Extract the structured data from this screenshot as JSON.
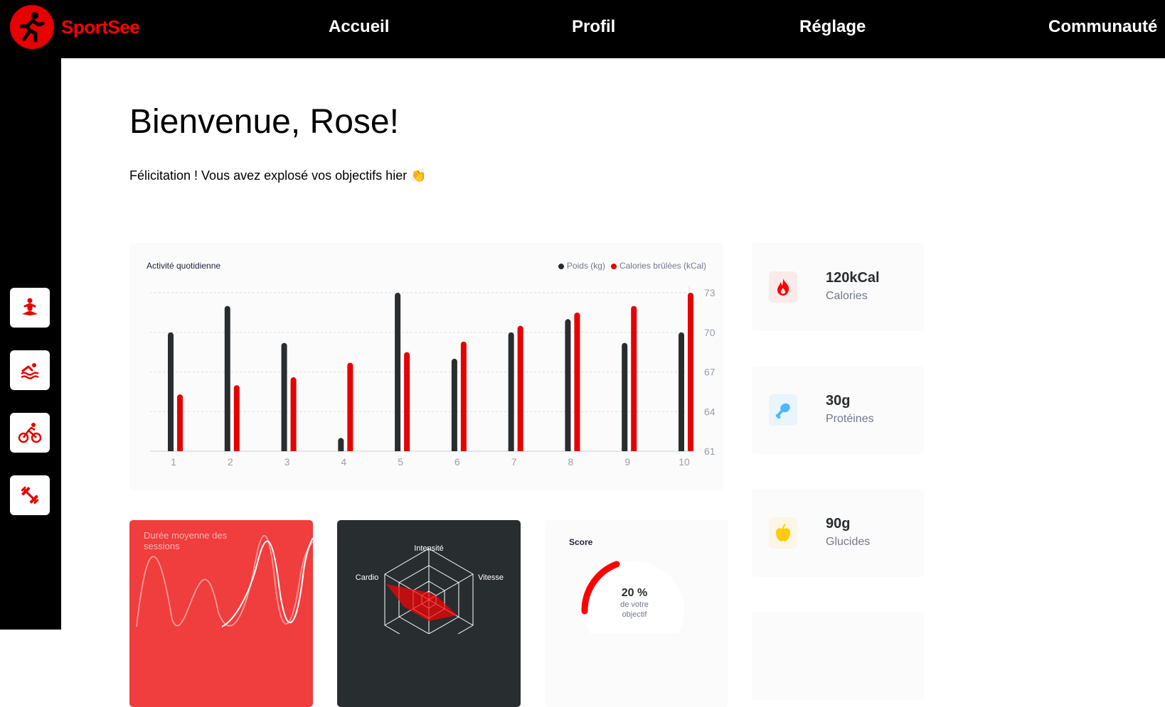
{
  "brand": {
    "name": "SportSee"
  },
  "nav": {
    "items": [
      "Accueil",
      "Profil",
      "Réglage",
      "Communauté"
    ]
  },
  "sidebar": {
    "icons": [
      "meditation-icon",
      "swimming-icon",
      "cycling-icon",
      "dumbbell-icon"
    ]
  },
  "header": {
    "greeting": "Bienvenue, Rose!",
    "congrats": "Félicitation ! Vous avez explosé vos objectifs hier 👏"
  },
  "activity": {
    "title": "Activité quotidienne",
    "legend_weight": "Poids (kg)",
    "legend_calories": "Calories brûlées (kCal)"
  },
  "avg_sessions": {
    "title": "Durée moyenne des sessions"
  },
  "performance": {
    "labels": [
      "Intensité",
      "Vitesse",
      "Cardio"
    ]
  },
  "score": {
    "title": "Score",
    "value": "20 %",
    "caption_line1": "de votre",
    "caption_line2": "objectif"
  },
  "stats": [
    {
      "value": "120kCal",
      "label": "Calories",
      "icon": "flame-icon",
      "bg": "#fbeaea",
      "color": "#ff0000"
    },
    {
      "value": "30g",
      "label": "Protéines",
      "icon": "chicken-icon",
      "bg": "#e9f4fb",
      "color": "#4ab8ff"
    },
    {
      "value": "90g",
      "label": "Glucides",
      "icon": "apple-icon",
      "bg": "#fbf6e5",
      "color": "#fdcc0c"
    }
  ],
  "colors": {
    "accent": "#e60000",
    "weight": "#282d30",
    "calories": "#e60000"
  },
  "chart_data": {
    "type": "bar",
    "title": "Activité quotidienne",
    "categories": [
      "1",
      "2",
      "3",
      "4",
      "5",
      "6",
      "7",
      "8",
      "9",
      "10"
    ],
    "y_ticks": [
      61,
      64,
      67,
      70,
      73
    ],
    "ylim": [
      61,
      73
    ],
    "series": [
      {
        "name": "Poids (kg)",
        "values": [
          70,
          72,
          69.2,
          62,
          73,
          68,
          70,
          71,
          69.2,
          70
        ]
      },
      {
        "name": "Calories brûlées (kCal)",
        "values": [
          65.3,
          66,
          66.6,
          67.7,
          68.5,
          69.3,
          70.5,
          71.5,
          72,
          73
        ]
      }
    ],
    "grid": true,
    "legend": "top-right"
  }
}
